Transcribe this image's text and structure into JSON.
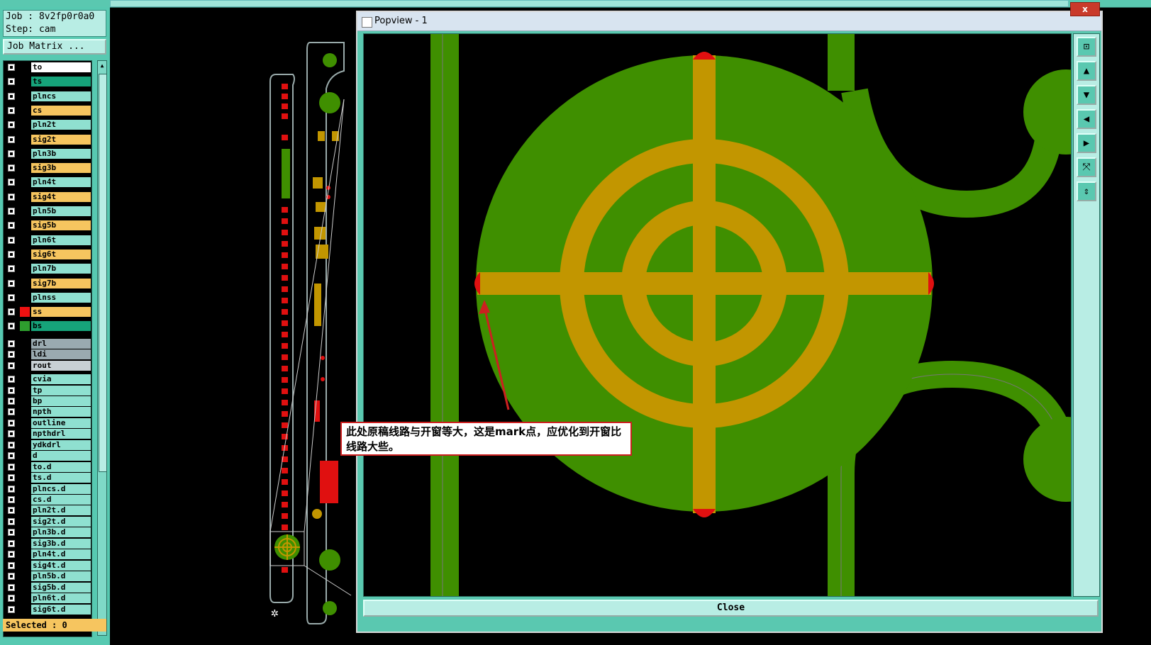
{
  "job": {
    "job_line": "Job : 8v2fp0r0a0",
    "step_line": "Step: cam"
  },
  "job_matrix_label": "Job Matrix ...",
  "layers": [
    {
      "name": "to",
      "swatch": "#000000",
      "color": "#ffffff"
    },
    {
      "name": "ts",
      "swatch": "#000000",
      "color": "#16a37a"
    },
    {
      "name": "plncs",
      "swatch": "#000000",
      "color": "#8fe0d0"
    },
    {
      "name": "cs",
      "swatch": "#000000",
      "color": "#f6c55f"
    },
    {
      "name": "pln2t",
      "swatch": "#000000",
      "color": "#8fe0d0"
    },
    {
      "name": "sig2t",
      "swatch": "#000000",
      "color": "#f6c55f"
    },
    {
      "name": "pln3b",
      "swatch": "#000000",
      "color": "#8fe0d0"
    },
    {
      "name": "sig3b",
      "swatch": "#000000",
      "color": "#f6c55f"
    },
    {
      "name": "pln4t",
      "swatch": "#000000",
      "color": "#8fe0d0"
    },
    {
      "name": "sig4t",
      "swatch": "#000000",
      "color": "#f6c55f"
    },
    {
      "name": "pln5b",
      "swatch": "#000000",
      "color": "#8fe0d0"
    },
    {
      "name": "sig5b",
      "swatch": "#000000",
      "color": "#f6c55f"
    },
    {
      "name": "pln6t",
      "swatch": "#000000",
      "color": "#8fe0d0"
    },
    {
      "name": "sig6t",
      "swatch": "#000000",
      "color": "#f6c55f"
    },
    {
      "name": "pln7b",
      "swatch": "#000000",
      "color": "#8fe0d0"
    },
    {
      "name": "sig7b",
      "swatch": "#000000",
      "color": "#f6c55f"
    },
    {
      "name": "plnss",
      "swatch": "#000000",
      "color": "#8fe0d0"
    },
    {
      "name": "ss",
      "swatch": "#ee1111",
      "color": "#f6c55f"
    },
    {
      "name": "bs",
      "swatch": "#2e9e2e",
      "color": "#16a37a"
    },
    {
      "name": "drl",
      "swatch": "#000000",
      "color": "#9aaab0"
    },
    {
      "name": "ldi",
      "swatch": "#000000",
      "color": "#9aaab0"
    },
    {
      "name": "rout",
      "swatch": "#000000",
      "color": "#c8d0d4"
    },
    {
      "name": "cvia",
      "swatch": "#000000",
      "color": "#8fe0d0"
    },
    {
      "name": "tp",
      "swatch": "#000000",
      "color": "#8fe0d0"
    },
    {
      "name": "bp",
      "swatch": "#000000",
      "color": "#8fe0d0"
    },
    {
      "name": "npth",
      "swatch": "#000000",
      "color": "#8fe0d0"
    },
    {
      "name": "outline",
      "swatch": "#000000",
      "color": "#8fe0d0"
    },
    {
      "name": "npthdrl",
      "swatch": "#000000",
      "color": "#8fe0d0"
    },
    {
      "name": "ydkdrl",
      "swatch": "#000000",
      "color": "#8fe0d0"
    },
    {
      "name": "d",
      "swatch": "#000000",
      "color": "#8fe0d0"
    },
    {
      "name": "to.d",
      "swatch": "#000000",
      "color": "#8fe0d0"
    },
    {
      "name": "ts.d",
      "swatch": "#000000",
      "color": "#8fe0d0"
    },
    {
      "name": "plncs.d",
      "swatch": "#000000",
      "color": "#8fe0d0"
    },
    {
      "name": "cs.d",
      "swatch": "#000000",
      "color": "#8fe0d0"
    },
    {
      "name": "pln2t.d",
      "swatch": "#000000",
      "color": "#8fe0d0"
    },
    {
      "name": "sig2t.d",
      "swatch": "#000000",
      "color": "#8fe0d0"
    },
    {
      "name": "pln3b.d",
      "swatch": "#000000",
      "color": "#8fe0d0"
    },
    {
      "name": "sig3b.d",
      "swatch": "#000000",
      "color": "#8fe0d0"
    },
    {
      "name": "pln4t.d",
      "swatch": "#000000",
      "color": "#8fe0d0"
    },
    {
      "name": "sig4t.d",
      "swatch": "#000000",
      "color": "#8fe0d0"
    },
    {
      "name": "pln5b.d",
      "swatch": "#000000",
      "color": "#8fe0d0"
    },
    {
      "name": "sig5b.d",
      "swatch": "#000000",
      "color": "#8fe0d0"
    },
    {
      "name": "pln6t.d",
      "swatch": "#000000",
      "color": "#8fe0d0"
    },
    {
      "name": "sig6t.d",
      "swatch": "#000000",
      "color": "#8fe0d0"
    }
  ],
  "status_text": "Selected : 0",
  "popview": {
    "title": "Popview - 1",
    "close_label": "Close",
    "close_x": "x",
    "tools": [
      "zoom-window-icon",
      "pan-up-icon",
      "pan-down-icon",
      "pan-left-icon",
      "pan-right-icon",
      "fit-screen-icon",
      "zoom-fit-icon"
    ]
  },
  "annotation": "此处原稿线路与开窗等大，这是mark点，应优化到开窗比线路大些。",
  "colors": {
    "panel": "#57c9b1",
    "copper": "#c29600",
    "mask": "#3f8f00",
    "pad_red": "#e01010"
  }
}
